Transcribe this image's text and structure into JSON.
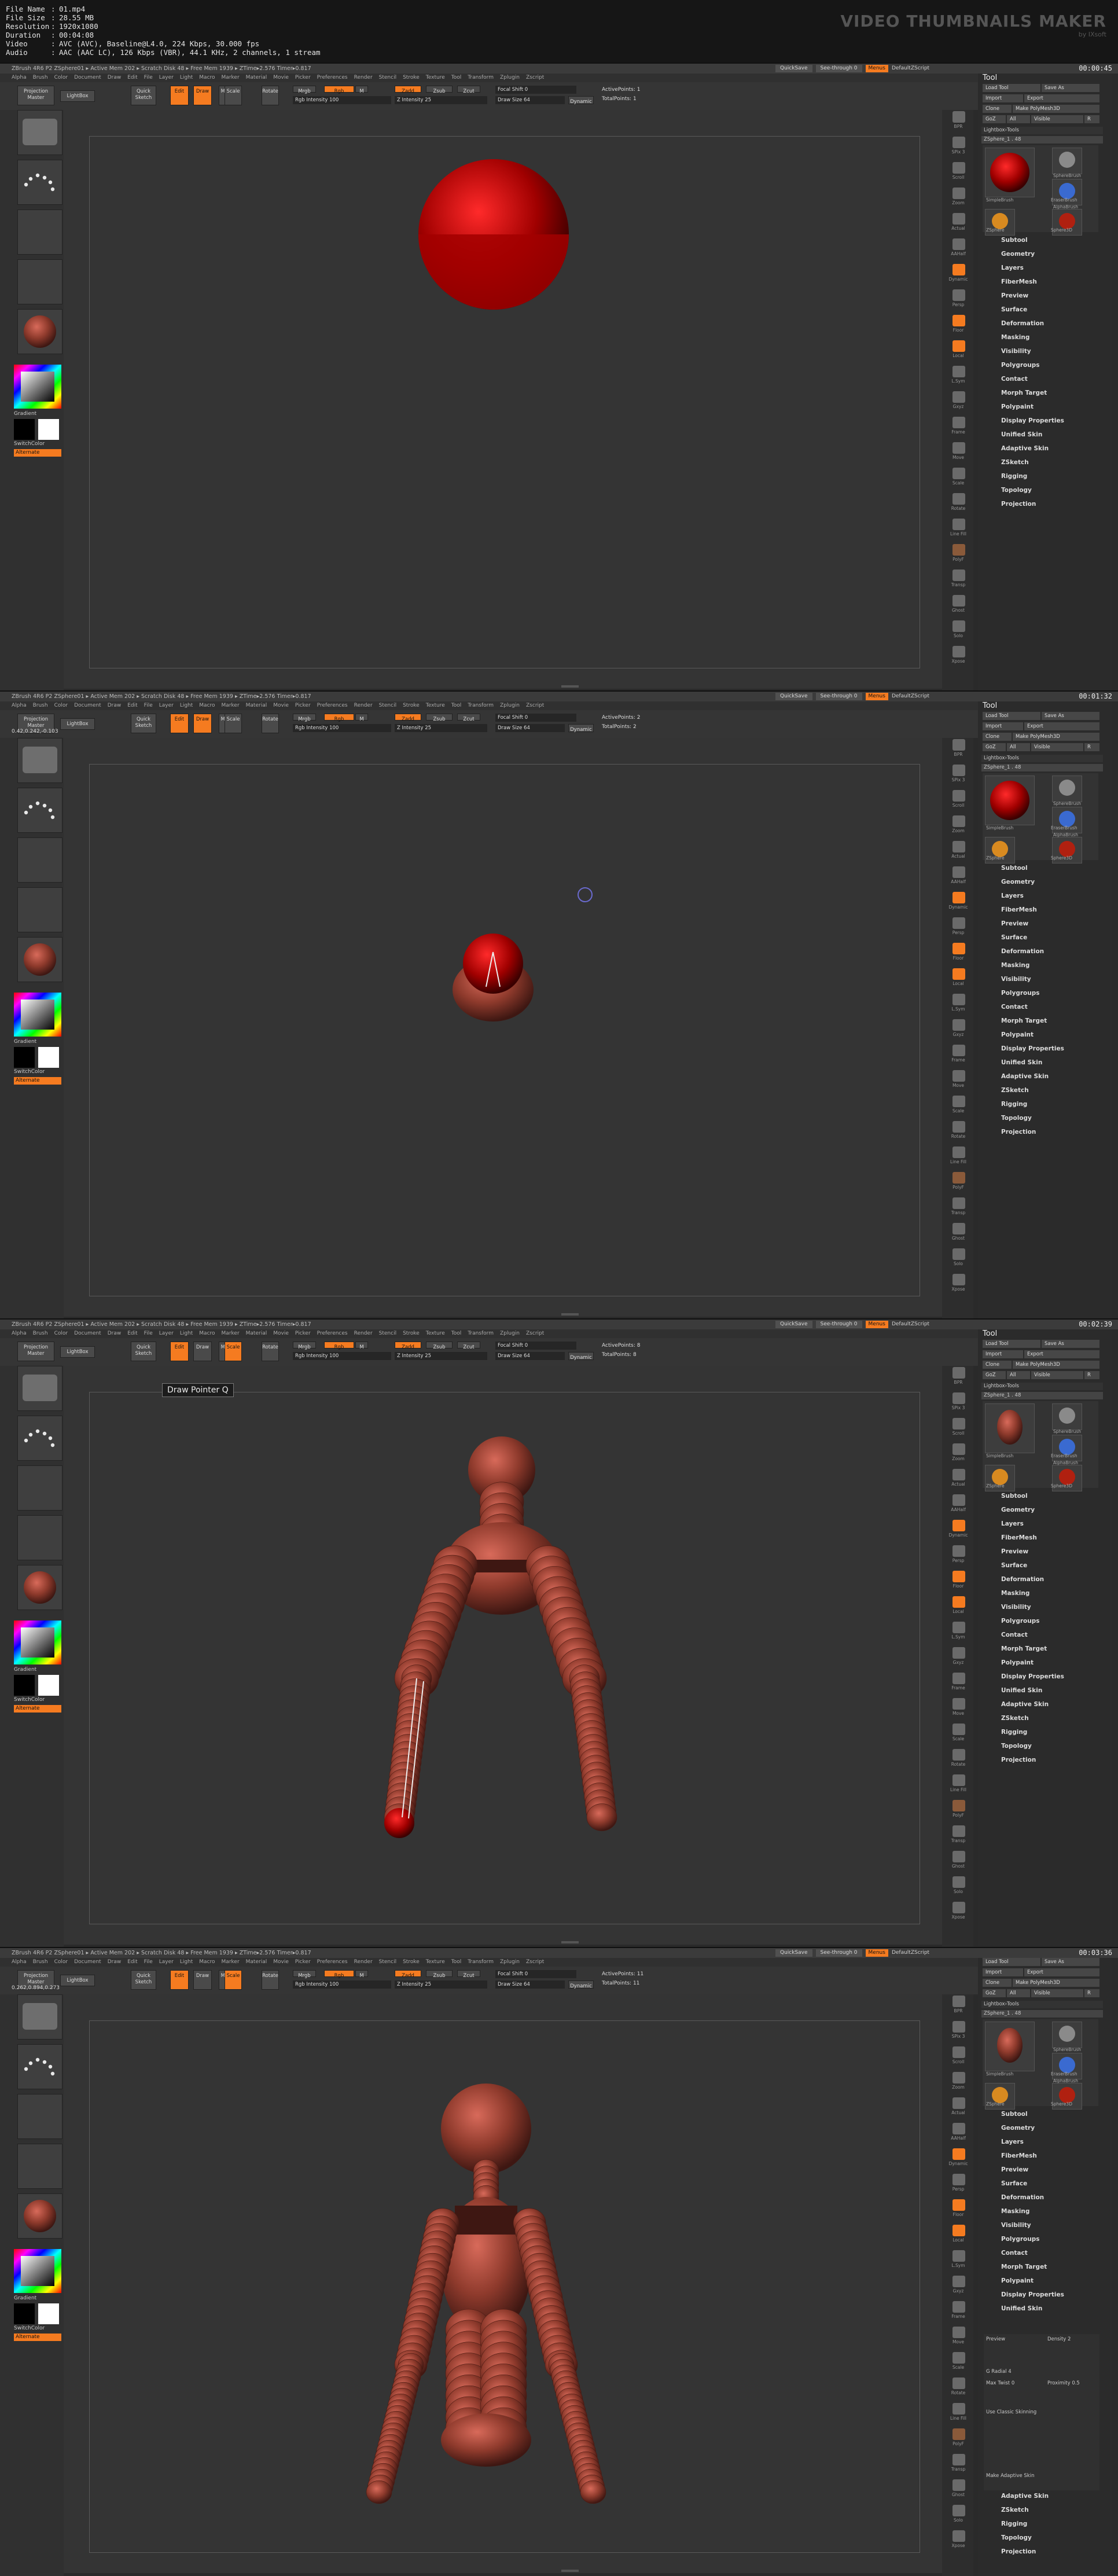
{
  "header": {
    "meta": [
      {
        "key": "File Name",
        "value": "01.mp4"
      },
      {
        "key": "File Size",
        "value": "28.55 MB"
      },
      {
        "key": "Resolution",
        "value": "1920x1080"
      },
      {
        "key": "Duration",
        "value": "00:04:08"
      },
      {
        "key": "Video",
        "value": "AVC (AVC), Baseline@L4.0, 224 Kbps, 30.000 fps"
      },
      {
        "key": "Audio",
        "value": "AAC (AAC LC), 126 Kbps (VBR), 44.1 KHz, 2 channels, 1 stream"
      }
    ],
    "sep": ":",
    "brand_title": "VIDEO THUMBNAILS MAKER",
    "brand_sub": "by IXsoft"
  },
  "common": {
    "titlebar_right": {
      "quicksave": "QuickSave",
      "seethrough": "See-through  0",
      "menus": "Menus",
      "script": "DefaultZScript"
    },
    "menu": [
      "Alpha",
      "Brush",
      "Color",
      "Document",
      "Draw",
      "Edit",
      "File",
      "Layer",
      "Light",
      "Macro",
      "Marker",
      "Material",
      "Movie",
      "Picker",
      "Preferences",
      "Render",
      "Stencil",
      "Stroke",
      "Texture",
      "Tool",
      "Transform",
      "Zplugin",
      "Zscript"
    ],
    "toolbar": {
      "projection_master": "Projection Master",
      "lightbox": "LightBox",
      "quick_sketch": "Quick Sketch",
      "edit": "Edit",
      "draw": "Draw",
      "move": "Move",
      "scale": "Scale",
      "rotate": "Rotate",
      "mrgb": "Mrgb",
      "rgb": "Rgb",
      "m": "M",
      "zadd": "Zadd",
      "zsub": "Zsub",
      "zcut": "Zcut",
      "focal_shift": "Focal Shift 0",
      "draw_size": "Draw Size 64",
      "dynamic": "Dynamic",
      "rgb_intensity": "Rgb Intensity 100",
      "z_intensity": "Z Intensity 25"
    },
    "left": {
      "gradient": "Gradient",
      "switchcolor": "SwitchColor",
      "alternate": "Alternate"
    },
    "right_icons": [
      "BPR",
      "SPix 3",
      "Scroll",
      "Zoom",
      "Actual",
      "AAHalf",
      "Dynamic",
      "Persp",
      "Floor",
      "Local",
      "L.Sym",
      "Gxyz",
      "Frame",
      "Move",
      "Scale",
      "Rotate",
      "Line Fill",
      "PolyF",
      "Transp",
      "Ghost",
      "Solo",
      "Xpose"
    ],
    "tool": {
      "title": "Tool",
      "load_tool": "Load Tool",
      "save_as": "Save As",
      "import": "Import",
      "export": "Export",
      "clone": "Clone",
      "make_polymesh": "Make PolyMesh3D",
      "goz": "GoZ",
      "all": "All",
      "visible": "Visible",
      "r": "R",
      "lightbox_tools": "Lightbox›Tools",
      "thumb_labels": [
        "SphereBrush",
        "AlphaBrush",
        "SimpleBrush",
        "EraserBrush",
        "ZSphere",
        "Sphere3D"
      ],
      "subpalettes": [
        "Subtool",
        "Geometry",
        "Layers",
        "FiberMesh",
        "Preview",
        "Surface",
        "Deformation",
        "Masking",
        "Visibility",
        "Polygroups",
        "Contact",
        "Morph Target",
        "Polypaint",
        "Display Properties",
        "Unified Skin",
        "Adaptive Skin",
        "ZSketch",
        "Rigging",
        "Topology",
        "Projection"
      ]
    }
  },
  "frames": [
    {
      "titlebar": "ZBrush 4R6 P2    ZSphere01    ▸ Active Mem 202 ▸ Scratch Disk 48 ▸ Free Mem 1939 ▸ ZTime▸2.576 Timer▸0.817",
      "counter": "00:00:45",
      "tool_name": "ZSphere_1 . 48",
      "active_points": "ActivePoints: 1",
      "total_points": "TotalPoints: 1"
    },
    {
      "titlebar": "ZBrush 4R6 P2    ZSphere01    ▸ Active Mem 202 ▸ Scratch Disk 48 ▸ Free Mem 1939 ▸ ZTime▸2.576 Timer▸0.817",
      "counter": "00:01:32",
      "coords": "0.42,0.242,-0.103",
      "tool_name": "ZSphere_1 . 48",
      "active_points": "ActivePoints: 2",
      "total_points": "TotalPoints: 2"
    },
    {
      "titlebar": "ZBrush 4R6 P2    ZSphere01    ▸ Active Mem 202 ▸ Scratch Disk 48 ▸ Free Mem 1939 ▸ ZTime▸2.576 Timer▸0.817",
      "counter": "00:02:39",
      "tool_name": "ZSphere_1 . 48",
      "active_points": "ActivePoints: 8",
      "total_points": "TotalPoints: 8",
      "tooltip": "Draw Pointer  Q"
    },
    {
      "titlebar": "ZBrush 4R6 P2    ZSphere01    ▸ Active Mem 202 ▸ Scratch Disk 48 ▸ Free Mem 1939 ▸ ZTime▸2.576 Timer▸0.817",
      "counter": "00:03:36",
      "coords": "0.262,0.894,0.273",
      "tool_name": "ZSphere_1 . 48",
      "active_points": "ActivePoints: 11",
      "total_points": "TotalPoints: 11",
      "adaptive_skin": {
        "header": "Adaptive Skin",
        "preview": "Preview",
        "density": "Density 2",
        "g_radial": "G Radial 4",
        "max_twist": "Max Twist 0",
        "proximity": "Proximity 0.5",
        "use_classic": "Use Classic Skinning",
        "make": "Make Adaptive Skin"
      }
    }
  ]
}
